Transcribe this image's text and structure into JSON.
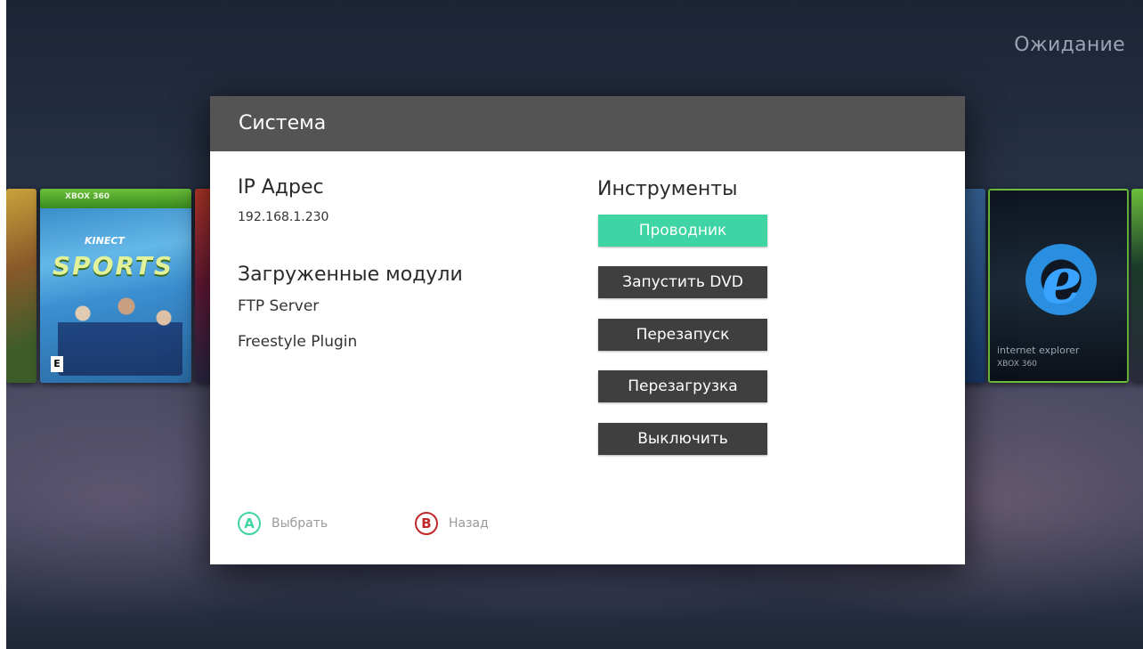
{
  "status": {
    "text": "Ожидание"
  },
  "background_covers": {
    "kinect_cover": {
      "title_art": "SPORTS",
      "subtitle_art": "KINECT",
      "band_label": "XBOX 360",
      "rating": "E"
    },
    "ie_cover": {
      "caption": "internet explorer",
      "platform": "XBOX 360"
    }
  },
  "dialog": {
    "title": "Система",
    "ip_section": {
      "title": "IP Адрес",
      "value": "192.168.1.230"
    },
    "modules_section": {
      "title": "Загруженные модули",
      "items": [
        "FTP Server",
        "Freestyle Plugin"
      ]
    },
    "tools_section": {
      "title": "Инструменты",
      "buttons": [
        {
          "label": "Проводник",
          "selected": true
        },
        {
          "label": "Запустить DVD",
          "selected": false
        },
        {
          "label": "Перезапуск",
          "selected": false
        },
        {
          "label": "Перезагрузка",
          "selected": false
        },
        {
          "label": "Выключить",
          "selected": false
        }
      ]
    },
    "hints": [
      {
        "key": "A",
        "label": "Выбрать",
        "color": "#3ed4a4"
      },
      {
        "key": "B",
        "label": "Назад",
        "color": "#c0282a"
      }
    ]
  },
  "colors": {
    "accent": "#3ed4a4",
    "header": "#545454",
    "button": "#3f3f3f",
    "back_red": "#c0282a"
  }
}
